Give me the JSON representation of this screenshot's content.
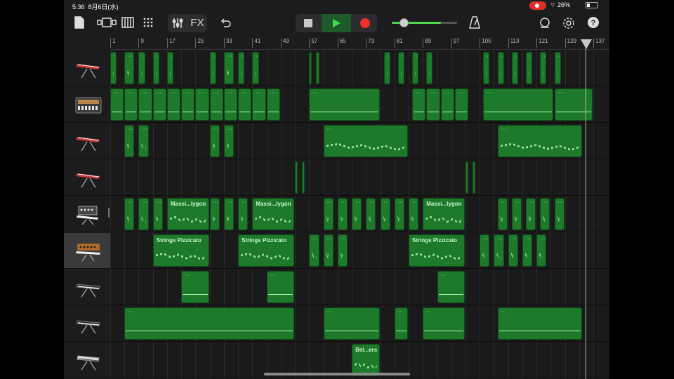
{
  "status_bar": {
    "time": "5:36",
    "date": "8月6日(水)",
    "battery": "26%"
  },
  "toolbar": {
    "fx_label": "FX"
  },
  "volume": {
    "level": 0.75
  },
  "ruler": {
    "bars": [
      "1",
      "9",
      "17",
      "25",
      "33",
      "41",
      "49",
      "57",
      "65",
      "73",
      "81",
      "89",
      "97",
      "105",
      "113",
      "121",
      "129",
      "137"
    ]
  },
  "playhead_bar": 130,
  "selected_track": 5,
  "tracks": [
    {
      "instrument": "red-keyboard-icon",
      "regions": [
        {
          "start": 1,
          "len": 2
        },
        {
          "start": 5,
          "len": 3
        },
        {
          "start": 9,
          "len": 2
        },
        {
          "start": 13,
          "len": 2
        },
        {
          "start": 17,
          "len": 2
        },
        {
          "start": 29,
          "len": 2
        },
        {
          "start": 33,
          "len": 3
        },
        {
          "start": 37,
          "len": 2
        },
        {
          "start": 41,
          "len": 2
        },
        {
          "start": 57,
          "len": 1
        },
        {
          "start": 59,
          "len": 1
        },
        {
          "start": 78,
          "len": 2
        },
        {
          "start": 82,
          "len": 2
        },
        {
          "start": 86,
          "len": 2
        },
        {
          "start": 90,
          "len": 2
        },
        {
          "start": 106,
          "len": 2
        },
        {
          "start": 110,
          "len": 2
        },
        {
          "start": 114,
          "len": 2
        },
        {
          "start": 118,
          "len": 2
        },
        {
          "start": 122,
          "len": 2
        },
        {
          "start": 126,
          "len": 2
        }
      ],
      "style": "notes"
    },
    {
      "instrument": "drum-machine-icon",
      "regions": [
        {
          "start": 1,
          "len": 4
        },
        {
          "start": 5,
          "len": 4
        },
        {
          "start": 9,
          "len": 4
        },
        {
          "start": 13,
          "len": 4
        },
        {
          "start": 17,
          "len": 4
        },
        {
          "start": 21,
          "len": 4
        },
        {
          "start": 25,
          "len": 4
        },
        {
          "start": 29,
          "len": 4
        },
        {
          "start": 33,
          "len": 4
        },
        {
          "start": 37,
          "len": 4
        },
        {
          "start": 41,
          "len": 4
        },
        {
          "start": 45,
          "len": 4
        },
        {
          "start": 57,
          "len": 20
        },
        {
          "start": 86,
          "len": 4
        },
        {
          "start": 90,
          "len": 4
        },
        {
          "start": 94,
          "len": 4
        },
        {
          "start": 98,
          "len": 4
        },
        {
          "start": 106,
          "len": 20
        },
        {
          "start": 126,
          "len": 11
        }
      ],
      "style": "beat"
    },
    {
      "instrument": "red-keyboard-icon",
      "regions": [
        {
          "start": 5,
          "len": 3
        },
        {
          "start": 9,
          "len": 3
        },
        {
          "start": 29,
          "len": 3
        },
        {
          "start": 33,
          "len": 3
        },
        {
          "start": 61,
          "len": 24
        },
        {
          "start": 110,
          "len": 24
        }
      ],
      "style": "notes"
    },
    {
      "instrument": "red-keyboard-icon",
      "regions": [
        {
          "start": 53,
          "len": 1
        },
        {
          "start": 55,
          "len": 1
        },
        {
          "start": 101,
          "len": 1
        },
        {
          "start": 103,
          "len": 1
        }
      ],
      "style": "notes"
    },
    {
      "instrument": "synth-module-icon",
      "regions": [
        {
          "start": 5,
          "len": 3
        },
        {
          "start": 9,
          "len": 3
        },
        {
          "start": 13,
          "len": 3
        },
        {
          "start": 17,
          "len": 12,
          "name": "Massi...lygon"
        },
        {
          "start": 29,
          "len": 3
        },
        {
          "start": 33,
          "len": 3
        },
        {
          "start": 37,
          "len": 3
        },
        {
          "start": 41,
          "len": 12,
          "name": "Massi...lygon"
        },
        {
          "start": 61,
          "len": 3
        },
        {
          "start": 65,
          "len": 3
        },
        {
          "start": 69,
          "len": 3
        },
        {
          "start": 73,
          "len": 3
        },
        {
          "start": 77,
          "len": 3
        },
        {
          "start": 81,
          "len": 3
        },
        {
          "start": 85,
          "len": 3
        },
        {
          "start": 89,
          "len": 12,
          "name": "Massi...lygon"
        },
        {
          "start": 110,
          "len": 3
        },
        {
          "start": 114,
          "len": 3
        },
        {
          "start": 118,
          "len": 3
        },
        {
          "start": 122,
          "len": 3
        },
        {
          "start": 126,
          "len": 3
        }
      ],
      "style": "notes"
    },
    {
      "instrument": "vintage-synth-icon",
      "regions": [
        {
          "start": 13,
          "len": 16,
          "name": "Strings Pizzicato"
        },
        {
          "start": 37,
          "len": 16,
          "name": "Strings Pizzicato"
        },
        {
          "start": 57,
          "len": 3
        },
        {
          "start": 61,
          "len": 3
        },
        {
          "start": 65,
          "len": 3
        },
        {
          "start": 85,
          "len": 16,
          "name": "Strings Pizzicato"
        },
        {
          "start": 105,
          "len": 3
        },
        {
          "start": 109,
          "len": 3
        },
        {
          "start": 113,
          "len": 3
        },
        {
          "start": 117,
          "len": 3
        },
        {
          "start": 121,
          "len": 3
        }
      ],
      "style": "notes"
    },
    {
      "instrument": "grand-keyboard-icon",
      "regions": [
        {
          "start": 21,
          "len": 8
        },
        {
          "start": 45,
          "len": 8
        },
        {
          "start": 93,
          "len": 8
        }
      ],
      "style": "beat"
    },
    {
      "instrument": "grand-keyboard-icon",
      "regions": [
        {
          "start": 5,
          "len": 48
        },
        {
          "start": 61,
          "len": 16
        },
        {
          "start": 81,
          "len": 4
        },
        {
          "start": 89,
          "len": 12
        },
        {
          "start": 110,
          "len": 24
        }
      ],
      "style": "beat"
    },
    {
      "instrument": "white-keyboard-icon",
      "regions": [
        {
          "start": 69,
          "len": 8,
          "name": "Bel...ers"
        }
      ],
      "style": "notes"
    }
  ]
}
